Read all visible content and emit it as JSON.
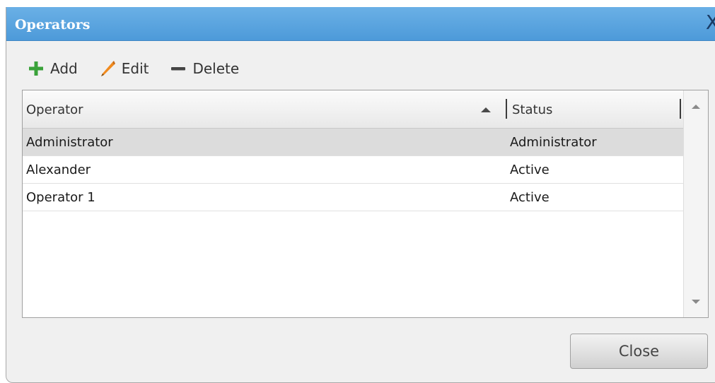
{
  "window": {
    "title": "Operators",
    "close_glyph": "X"
  },
  "toolbar": {
    "add_label": "Add",
    "edit_label": "Edit",
    "delete_label": "Delete",
    "add_icon": "plus-icon",
    "edit_icon": "pencil-icon",
    "delete_icon": "minus-icon"
  },
  "table": {
    "columns": [
      "Operator",
      "Status"
    ],
    "sort_column": "Operator",
    "sort_direction": "ascending",
    "rows": [
      {
        "operator": "Administrator",
        "status": "Administrator",
        "selected": true
      },
      {
        "operator": "Alexander",
        "status": "Active",
        "selected": false
      },
      {
        "operator": "Operator 1",
        "status": "Active",
        "selected": false
      }
    ]
  },
  "footer": {
    "close_label": "Close"
  },
  "colors": {
    "titlebar": "#5aa3de",
    "add_icon": "#3aa23a",
    "edit_icon": "#f08a1e",
    "delete_icon": "#444444",
    "selected_row": "#dcdcdc"
  }
}
